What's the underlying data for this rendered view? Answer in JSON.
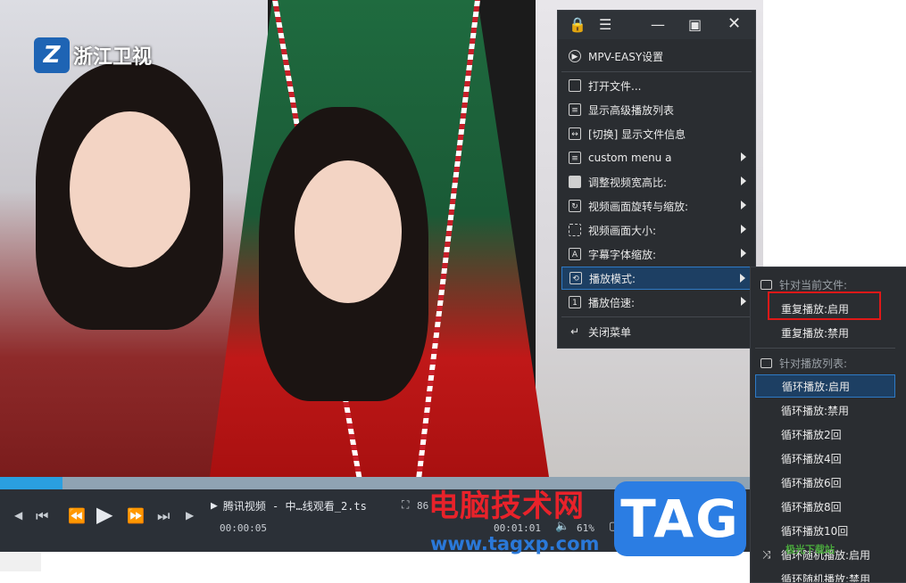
{
  "video": {
    "channel_logo_text": "浙江卫视",
    "channel_logo_mark": "Z"
  },
  "player": {
    "progress_fraction": 0.082,
    "file_title": "腾讯视频 - 中…线观看_2.ts",
    "elapsed": "00:00:05",
    "time2": "00:01:01",
    "volume": "61%",
    "zoom_partial": "86"
  },
  "menu": {
    "toolbar": {
      "lock": "lock-icon",
      "hamburger": "menu-icon",
      "minimize": "minimize-icon",
      "maximize": "maximize-icon",
      "close": "close-icon"
    },
    "items": [
      {
        "label": "MPV-EASY设置",
        "icon": "play-circle-icon"
      },
      {
        "label": "打开文件...",
        "icon": "folder-icon"
      },
      {
        "label": "显示高级播放列表",
        "icon": "list-icon"
      },
      {
        "label": "[切换] 显示文件信息",
        "icon": "swap-icon"
      },
      {
        "label": "custom menu a",
        "icon": "custom-icon"
      },
      {
        "label": "调整视频宽高比:",
        "icon": "aspect-icon"
      },
      {
        "label": "视频画面旋转与缩放:",
        "icon": "rotate-icon"
      },
      {
        "label": "视频画面大小:",
        "icon": "resize-icon"
      },
      {
        "label": "字幕字体缩放:",
        "icon": "font-icon"
      },
      {
        "label": "播放模式:",
        "icon": "repeat-icon"
      },
      {
        "label": "播放倍速:",
        "icon": "speed-icon"
      },
      {
        "label": "关闭菜单",
        "icon": "exit-icon"
      }
    ]
  },
  "submenu": {
    "header_current": "针对当前文件:",
    "repeat_on": "重复播放:启用",
    "repeat_off": "重复播放:禁用",
    "header_playlist": "针对播放列表:",
    "loop_on": "循环播放:启用",
    "loop_off": "循环播放:禁用",
    "loop_2": "循环播放2回",
    "loop_4": "循环播放4回",
    "loop_6": "循环播放6回",
    "loop_8": "循环播放8回",
    "loop_10": "循环播放10回",
    "shuffle_on": "循环随机播放:启用",
    "shuffle_off": "循环随机播放:禁用"
  },
  "watermark": {
    "title": "电脑技术网",
    "url": "www.tagxp.com",
    "tag": "TAG",
    "site": "极光下载站"
  },
  "colors": {
    "accent": "#2e7ac6",
    "highlight_box": "#e01818",
    "menu_bg": "#2a2d31"
  }
}
